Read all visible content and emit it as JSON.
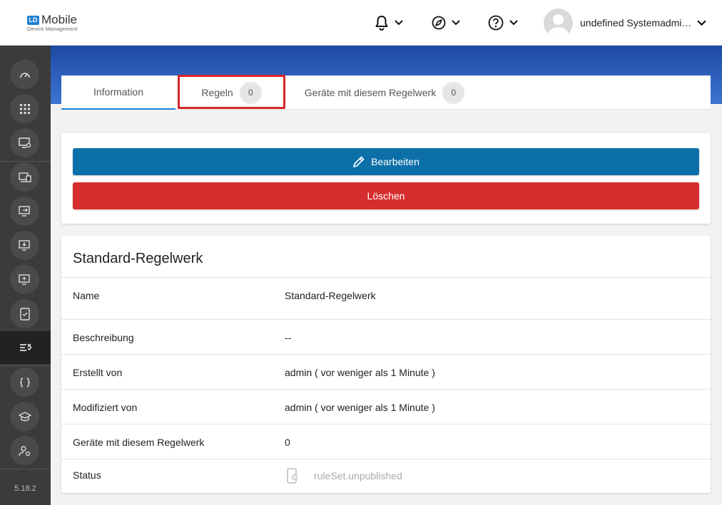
{
  "header": {
    "logo_badge": "LD",
    "logo_title": "Mobile",
    "logo_subtitle": "Device Management",
    "user_name": "undefined Systemadministrator"
  },
  "icons": {
    "notifications": "bell-icon",
    "compass": "compass-icon",
    "help": "help-icon",
    "dropdown": "chevron-down-icon"
  },
  "sidebar": {
    "items": [
      "dashboard-icon",
      "apps-grid-icon",
      "device-settings-icon",
      "devices-icon",
      "device-transfer-icon",
      "device-download-icon",
      "device-add-icon",
      "device-check-icon",
      "rules-icon",
      "code-icon",
      "learning-icon",
      "user-settings-icon"
    ],
    "version": "5.18.2"
  },
  "tabs": [
    {
      "label": "Information"
    },
    {
      "label": "Regeln",
      "count": "0"
    },
    {
      "label": "Geräte mit diesem Regelwerk",
      "count": "0"
    }
  ],
  "actions": {
    "edit_label": "Bearbeiten",
    "delete_label": "Löschen"
  },
  "details": {
    "title": "Standard-Regelwerk",
    "rows": [
      {
        "label": "Name",
        "value": "Standard-Regelwerk"
      },
      {
        "label": "Beschreibung",
        "value": "--"
      },
      {
        "label": "Erstellt von",
        "value": "admin ( vor weniger als 1 Minute )"
      },
      {
        "label": "Modifiziert von",
        "value": "admin ( vor weniger als 1 Minute )"
      },
      {
        "label": "Geräte mit diesem Regelwerk",
        "value": "0"
      },
      {
        "label": "Status",
        "value": "ruleSet.unpublished"
      }
    ]
  },
  "colors": {
    "primary": "#0d6fa8",
    "danger": "#d62e2e",
    "highlight": "#d8262b",
    "sidebar": "#3b3b3b",
    "banner": "#2a5cb8"
  }
}
